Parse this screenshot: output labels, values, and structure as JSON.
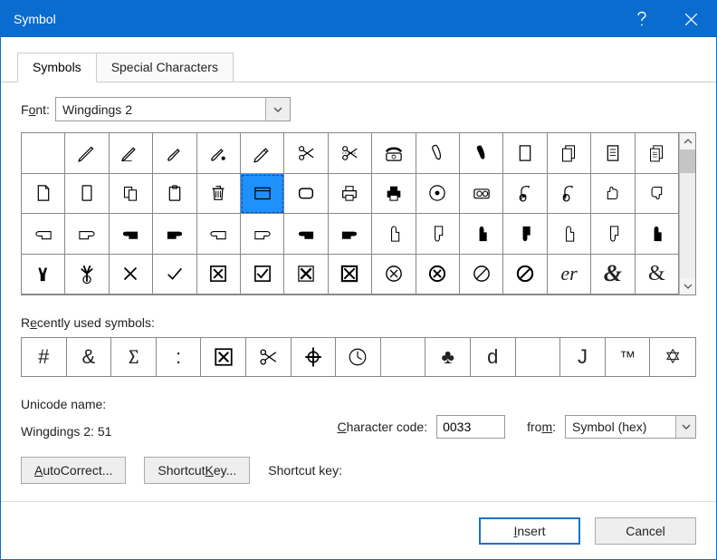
{
  "window": {
    "title": "Symbol"
  },
  "tabs": {
    "active": "Symbols",
    "inactive": "Special Characters"
  },
  "font": {
    "label_pre": "F",
    "label_und": "o",
    "label_post": "nt:",
    "value": "Wingdings 2"
  },
  "selected_index": 20,
  "recent_label_pre": "R",
  "recent_label_und": "e",
  "recent_label_post": "cently used symbols:",
  "unicode_name_label": "Unicode name:",
  "unicode_name_value": "Wingdings 2: 51",
  "char_code": {
    "label_und": "C",
    "label_post": "haracter code:",
    "value": "0033"
  },
  "from": {
    "label_pre": "fro",
    "label_und": "m",
    "label_post": ":",
    "value": "Symbol (hex)"
  },
  "buttons": {
    "autocorrect_und": "A",
    "autocorrect_post": "utoCorrect...",
    "shortcut_pre": "Shortcut ",
    "shortcut_und": "K",
    "shortcut_post": "ey...",
    "shortcut_label": "Shortcut key:",
    "insert_und": "I",
    "insert_post": "nsert",
    "cancel": "Cancel"
  },
  "recent_glyphs": [
    "#",
    "&",
    "∑",
    ":",
    "⊠",
    "✂",
    "⊕",
    "◷",
    "",
    "♣",
    "d",
    "",
    "J",
    "™",
    "✡"
  ],
  "main_grid_names": [
    "blank",
    "pen-icon",
    "pen-writing-icon",
    "brush-icon",
    "brush-drop-icon",
    "pencil-icon",
    "scissors-icon",
    "scissors-cut-icon",
    "telephone-icon",
    "phone-handset-icon",
    "phone-handset-solid-icon",
    "page-icon",
    "pages-icon",
    "document-icon",
    "documents-icon",
    "page-outline-icon",
    "phone-screen-icon",
    "pages-two-icon",
    "clipboard-icon",
    "trash-icon",
    "window-icon",
    "rounded-rect-icon",
    "printer-icon",
    "printer-solid-icon",
    "disc-icon",
    "camera-icon",
    "mouse-right-icon",
    "mouse-left-icon",
    "thumb-up-icon",
    "thumb-down-icon",
    "hand-point-left-outline-icon",
    "hand-point-right-outline-icon",
    "hand-point-left-solid-icon",
    "hand-point-right-solid-icon",
    "hand-point-left-thin-icon",
    "hand-point-right-thin-icon",
    "hand-point-left-black-icon",
    "hand-point-right-black-icon",
    "hand-point-up-outline-icon",
    "hand-point-down-outline-icon",
    "hand-point-up-black-icon",
    "hand-point-down-black-icon",
    "hand-point-up-thin-icon",
    "hand-point-down-thin-icon",
    "hand-point-up-solid-icon",
    "victory-hand-icon",
    "hand-spread-icon",
    "x-mark-icon",
    "check-mark-icon",
    "box-x-icon",
    "box-check-icon",
    "box-x-bold-icon",
    "box-x-heavy-icon",
    "circle-x-icon",
    "circle-x-bold-icon",
    "prohibited-icon",
    "prohibited-bold-icon",
    "er-script-icon",
    "ampersand-script-icon",
    "ampersand-light-icon"
  ]
}
